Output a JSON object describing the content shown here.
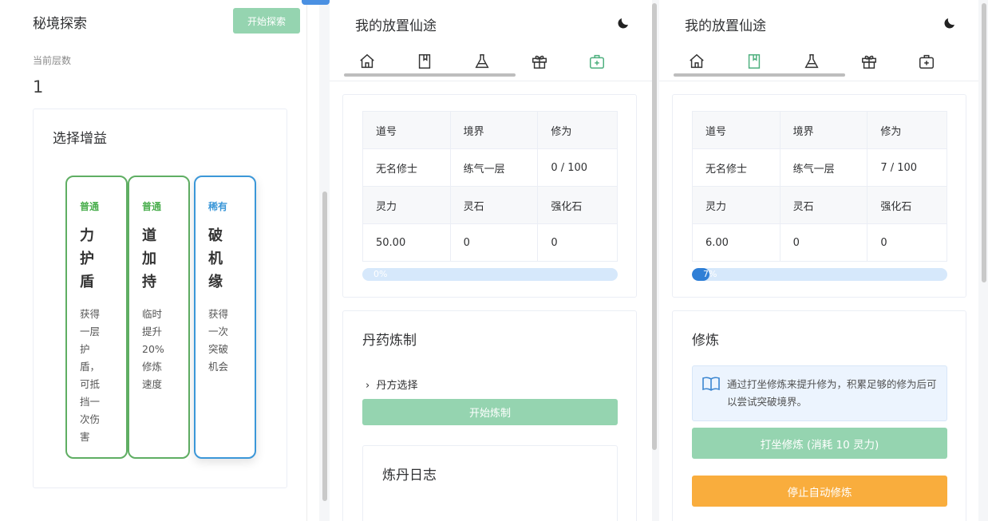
{
  "secret_realm": {
    "title": "秘境探索",
    "start_button": "开始探索",
    "floor_label": "当前层数",
    "floor_value": "1",
    "buff_title": "选择增益",
    "buffs": [
      {
        "rarity": "普通",
        "name": "力护盾",
        "desc": "获得一层护盾，可抵挡一次伤害"
      },
      {
        "rarity": "普通",
        "name": "道加持",
        "desc": "临时提升20%修炼速度"
      },
      {
        "rarity": "稀有",
        "name": "破机缘",
        "desc": "获得一次突破机会"
      }
    ]
  },
  "game_a": {
    "title": "我的放置仙途",
    "tabs": [
      "home-icon",
      "book-icon",
      "flask-icon",
      "gift-icon",
      "medkit-icon"
    ],
    "active_tab": 4,
    "table": {
      "h1": [
        "道号",
        "境界",
        "修为"
      ],
      "r1": [
        "无名修士",
        "练气一层",
        "0 / 100"
      ],
      "h2": [
        "灵力",
        "灵石",
        "强化石"
      ],
      "r2": [
        "50.00",
        "0",
        "0"
      ]
    },
    "progress": 0,
    "progress_text": "0%",
    "alchemy": {
      "title": "丹药炼制",
      "recipe": "丹方选择",
      "start_button": "开始炼制",
      "log_title": "炼丹日志"
    }
  },
  "game_b": {
    "title": "我的放置仙途",
    "tabs": [
      "home-icon",
      "book-icon",
      "flask-icon",
      "gift-icon",
      "medkit-icon"
    ],
    "active_tab": 1,
    "table": {
      "h1": [
        "道号",
        "境界",
        "修为"
      ],
      "r1": [
        "无名修士",
        "练气一层",
        "7 / 100"
      ],
      "h2": [
        "灵力",
        "灵石",
        "强化石"
      ],
      "r2": [
        "6.00",
        "0",
        "0"
      ]
    },
    "progress": 7,
    "progress_text": "7%",
    "cultivate": {
      "title": "修炼",
      "tip": "通过打坐修炼来提升修为，积累足够的修为后可以尝试突破境界。",
      "meditate_button": "打坐修炼 (消耗 10 灵力)",
      "stop_button": "停止自动修炼"
    }
  },
  "colors": {
    "green": "#95d4b0",
    "orange": "#f9ad3d",
    "blue": "#2f7fd6",
    "active": "#4caf7d"
  }
}
